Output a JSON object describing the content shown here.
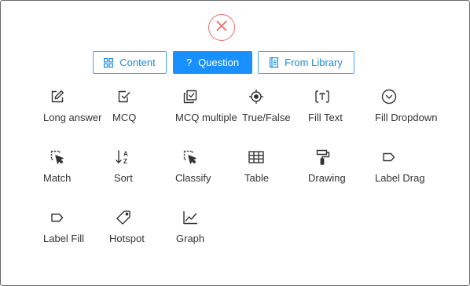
{
  "dialog": {
    "close_icon": "close-icon",
    "accent_color": "#1890ff",
    "close_color": "#ef6b6b"
  },
  "tabs": [
    {
      "label": "Content",
      "icon": "content-grid-icon",
      "active": false
    },
    {
      "label": "Question",
      "icon": "question-icon",
      "active": true
    },
    {
      "label": "From Library",
      "icon": "library-icon",
      "active": false
    }
  ],
  "question_types": [
    {
      "label": "Long answer",
      "icon": "edit-icon"
    },
    {
      "label": "MCQ",
      "icon": "checkbox-icon"
    },
    {
      "label": "MCQ multiple",
      "icon": "multi-checkbox-icon"
    },
    {
      "label": "True/False",
      "icon": "crosshair-icon"
    },
    {
      "label": "Fill Text",
      "icon": "fill-text-icon"
    },
    {
      "label": "Fill Dropdown",
      "icon": "dropdown-icon"
    },
    {
      "label": "Match",
      "icon": "select-pointer-icon"
    },
    {
      "label": "Sort",
      "icon": "sort-az-icon"
    },
    {
      "label": "Classify",
      "icon": "select-pointer-icon"
    },
    {
      "label": "Table",
      "icon": "table-icon"
    },
    {
      "label": "Drawing",
      "icon": "paint-roller-icon"
    },
    {
      "label": "Label Drag",
      "icon": "label-tag-icon"
    },
    {
      "label": "Label Fill",
      "icon": "label-tag-icon"
    },
    {
      "label": "Hotspot",
      "icon": "tag-icon"
    },
    {
      "label": "Graph",
      "icon": "line-graph-icon"
    }
  ]
}
